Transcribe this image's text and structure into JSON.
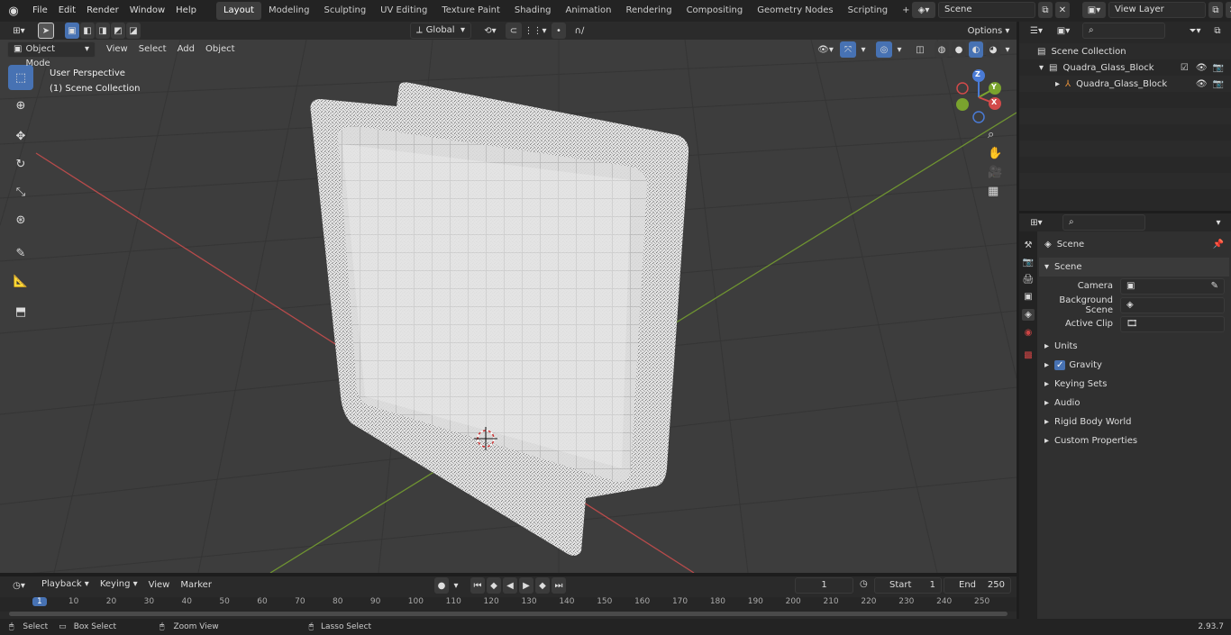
{
  "topbar": {
    "menus": [
      "File",
      "Edit",
      "Render",
      "Window",
      "Help"
    ],
    "workspaces": [
      "Layout",
      "Modeling",
      "Sculpting",
      "UV Editing",
      "Texture Paint",
      "Shading",
      "Animation",
      "Rendering",
      "Compositing",
      "Geometry Nodes",
      "Scripting"
    ],
    "active_workspace": "Layout",
    "scene": "Scene",
    "view_layer": "View Layer"
  },
  "tool_header": {
    "orientation": "Global",
    "options": "Options"
  },
  "viewport_header": {
    "mode": "Object Mode",
    "menus": [
      "View",
      "Select",
      "Add",
      "Object"
    ]
  },
  "viewport": {
    "perspective_label": "User Perspective",
    "collection_label": "(1) Scene Collection",
    "gizmo": {
      "x": "X",
      "y": "Y",
      "z": "Z"
    }
  },
  "toolbar_icons": [
    "select-box-icon",
    "cursor-icon",
    "move-icon",
    "rotate-icon",
    "scale-icon",
    "transform-icon",
    "annotate-icon",
    "measure-icon",
    "add-cube-icon"
  ],
  "outliner": {
    "root": "Scene Collection",
    "items": [
      {
        "label": "Quadra_Glass_Block"
      },
      {
        "label": "Quadra_Glass_Block"
      }
    ]
  },
  "properties": {
    "header": "Scene",
    "section": "Scene",
    "fields": [
      {
        "label": "Camera",
        "value": ""
      },
      {
        "label": "Background Scene",
        "value": ""
      },
      {
        "label": "Active Clip",
        "value": ""
      }
    ],
    "panels": [
      "Units",
      "Gravity",
      "Keying Sets",
      "Audio",
      "Rigid Body World",
      "Custom Properties"
    ]
  },
  "timeline": {
    "menus": [
      "Playback",
      "Keying",
      "View",
      "Marker"
    ],
    "current_frame": "1",
    "start_label": "Start",
    "start": "1",
    "end_label": "End",
    "end": "250",
    "ruler": [
      "1",
      "10",
      "20",
      "30",
      "40",
      "50",
      "60",
      "70",
      "80",
      "90",
      "100",
      "110",
      "120",
      "130",
      "140",
      "150",
      "160",
      "170",
      "180",
      "190",
      "200",
      "210",
      "220",
      "230",
      "240",
      "250"
    ]
  },
  "status": {
    "items": [
      "Select",
      "Box Select",
      "Zoom View",
      "Lasso Select"
    ],
    "version": "2.93.7"
  },
  "colors": {
    "accent": "#4772b3",
    "x_axis": "#c44848",
    "y_axis": "#7aa32e",
    "bg": "#3d3d3d"
  }
}
